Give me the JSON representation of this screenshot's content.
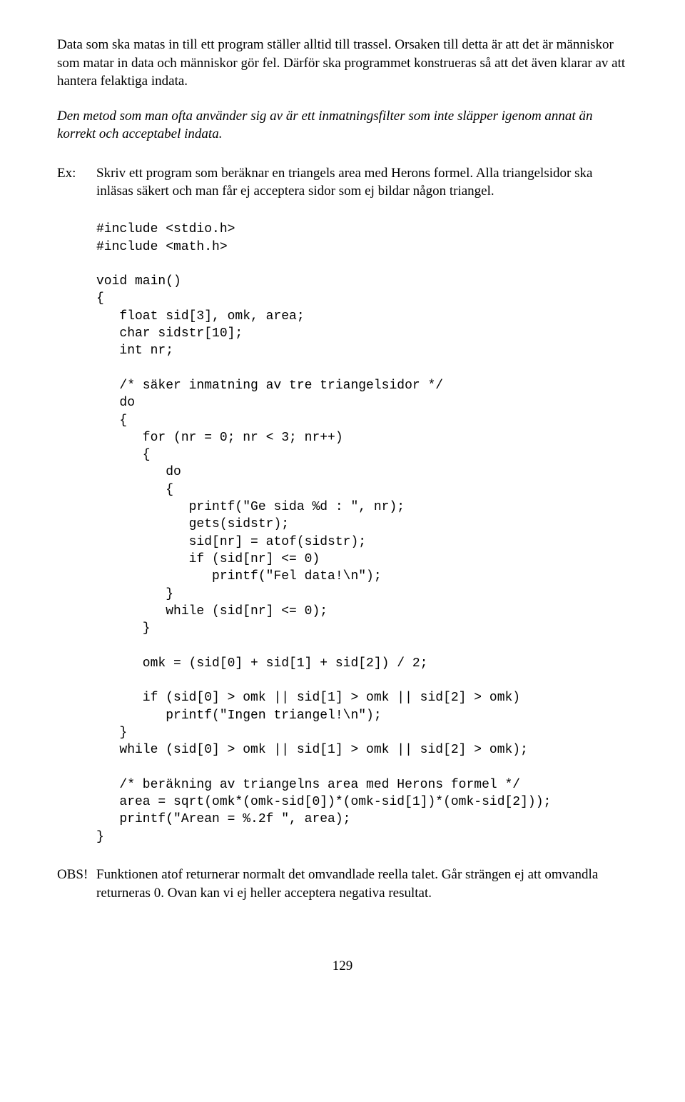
{
  "intro": {
    "para1": "Data som ska matas in till ett program ställer alltid till trassel. Orsaken till detta är att det är människor som matar in data och människor gör fel. Därför ska programmet konstrueras så att det även klarar av att hantera felaktiga indata.",
    "para2": "Den metod som man ofta använder sig av är ett inmatningsfilter som inte släpper igenom annat än korrekt och acceptabel indata."
  },
  "example": {
    "label": "Ex:",
    "text": "Skriv ett program som beräknar en triangels area med Herons formel. Alla triangelsidor ska inläsas säkert och man får ej acceptera sidor som ej bildar någon triangel."
  },
  "code": "#include <stdio.h>\n#include <math.h>\n\nvoid main()\n{\n   float sid[3], omk, area;\n   char sidstr[10];\n   int nr;\n\n   /* säker inmatning av tre triangelsidor */\n   do\n   {\n      for (nr = 0; nr < 3; nr++)\n      {\n         do\n         {\n            printf(\"Ge sida %d : \", nr);\n            gets(sidstr);\n            sid[nr] = atof(sidstr);\n            if (sid[nr] <= 0)\n               printf(\"Fel data!\\n\");\n         }\n         while (sid[nr] <= 0);\n      }\n\n      omk = (sid[0] + sid[1] + sid[2]) / 2;\n\n      if (sid[0] > omk || sid[1] > omk || sid[2] > omk)\n         printf(\"Ingen triangel!\\n\");\n   }\n   while (sid[0] > omk || sid[1] > omk || sid[2] > omk);\n\n   /* beräkning av triangelns area med Herons formel */\n   area = sqrt(omk*(omk-sid[0])*(omk-sid[1])*(omk-sid[2]));\n   printf(\"Arean = %.2f \", area);\n}",
  "obs": {
    "label": "OBS!",
    "text": "Funktionen atof returnerar normalt det omvandlade reella talet. Går strängen ej att omvandla returneras 0. Ovan kan vi ej heller acceptera negativa resultat."
  },
  "page_number": "129"
}
